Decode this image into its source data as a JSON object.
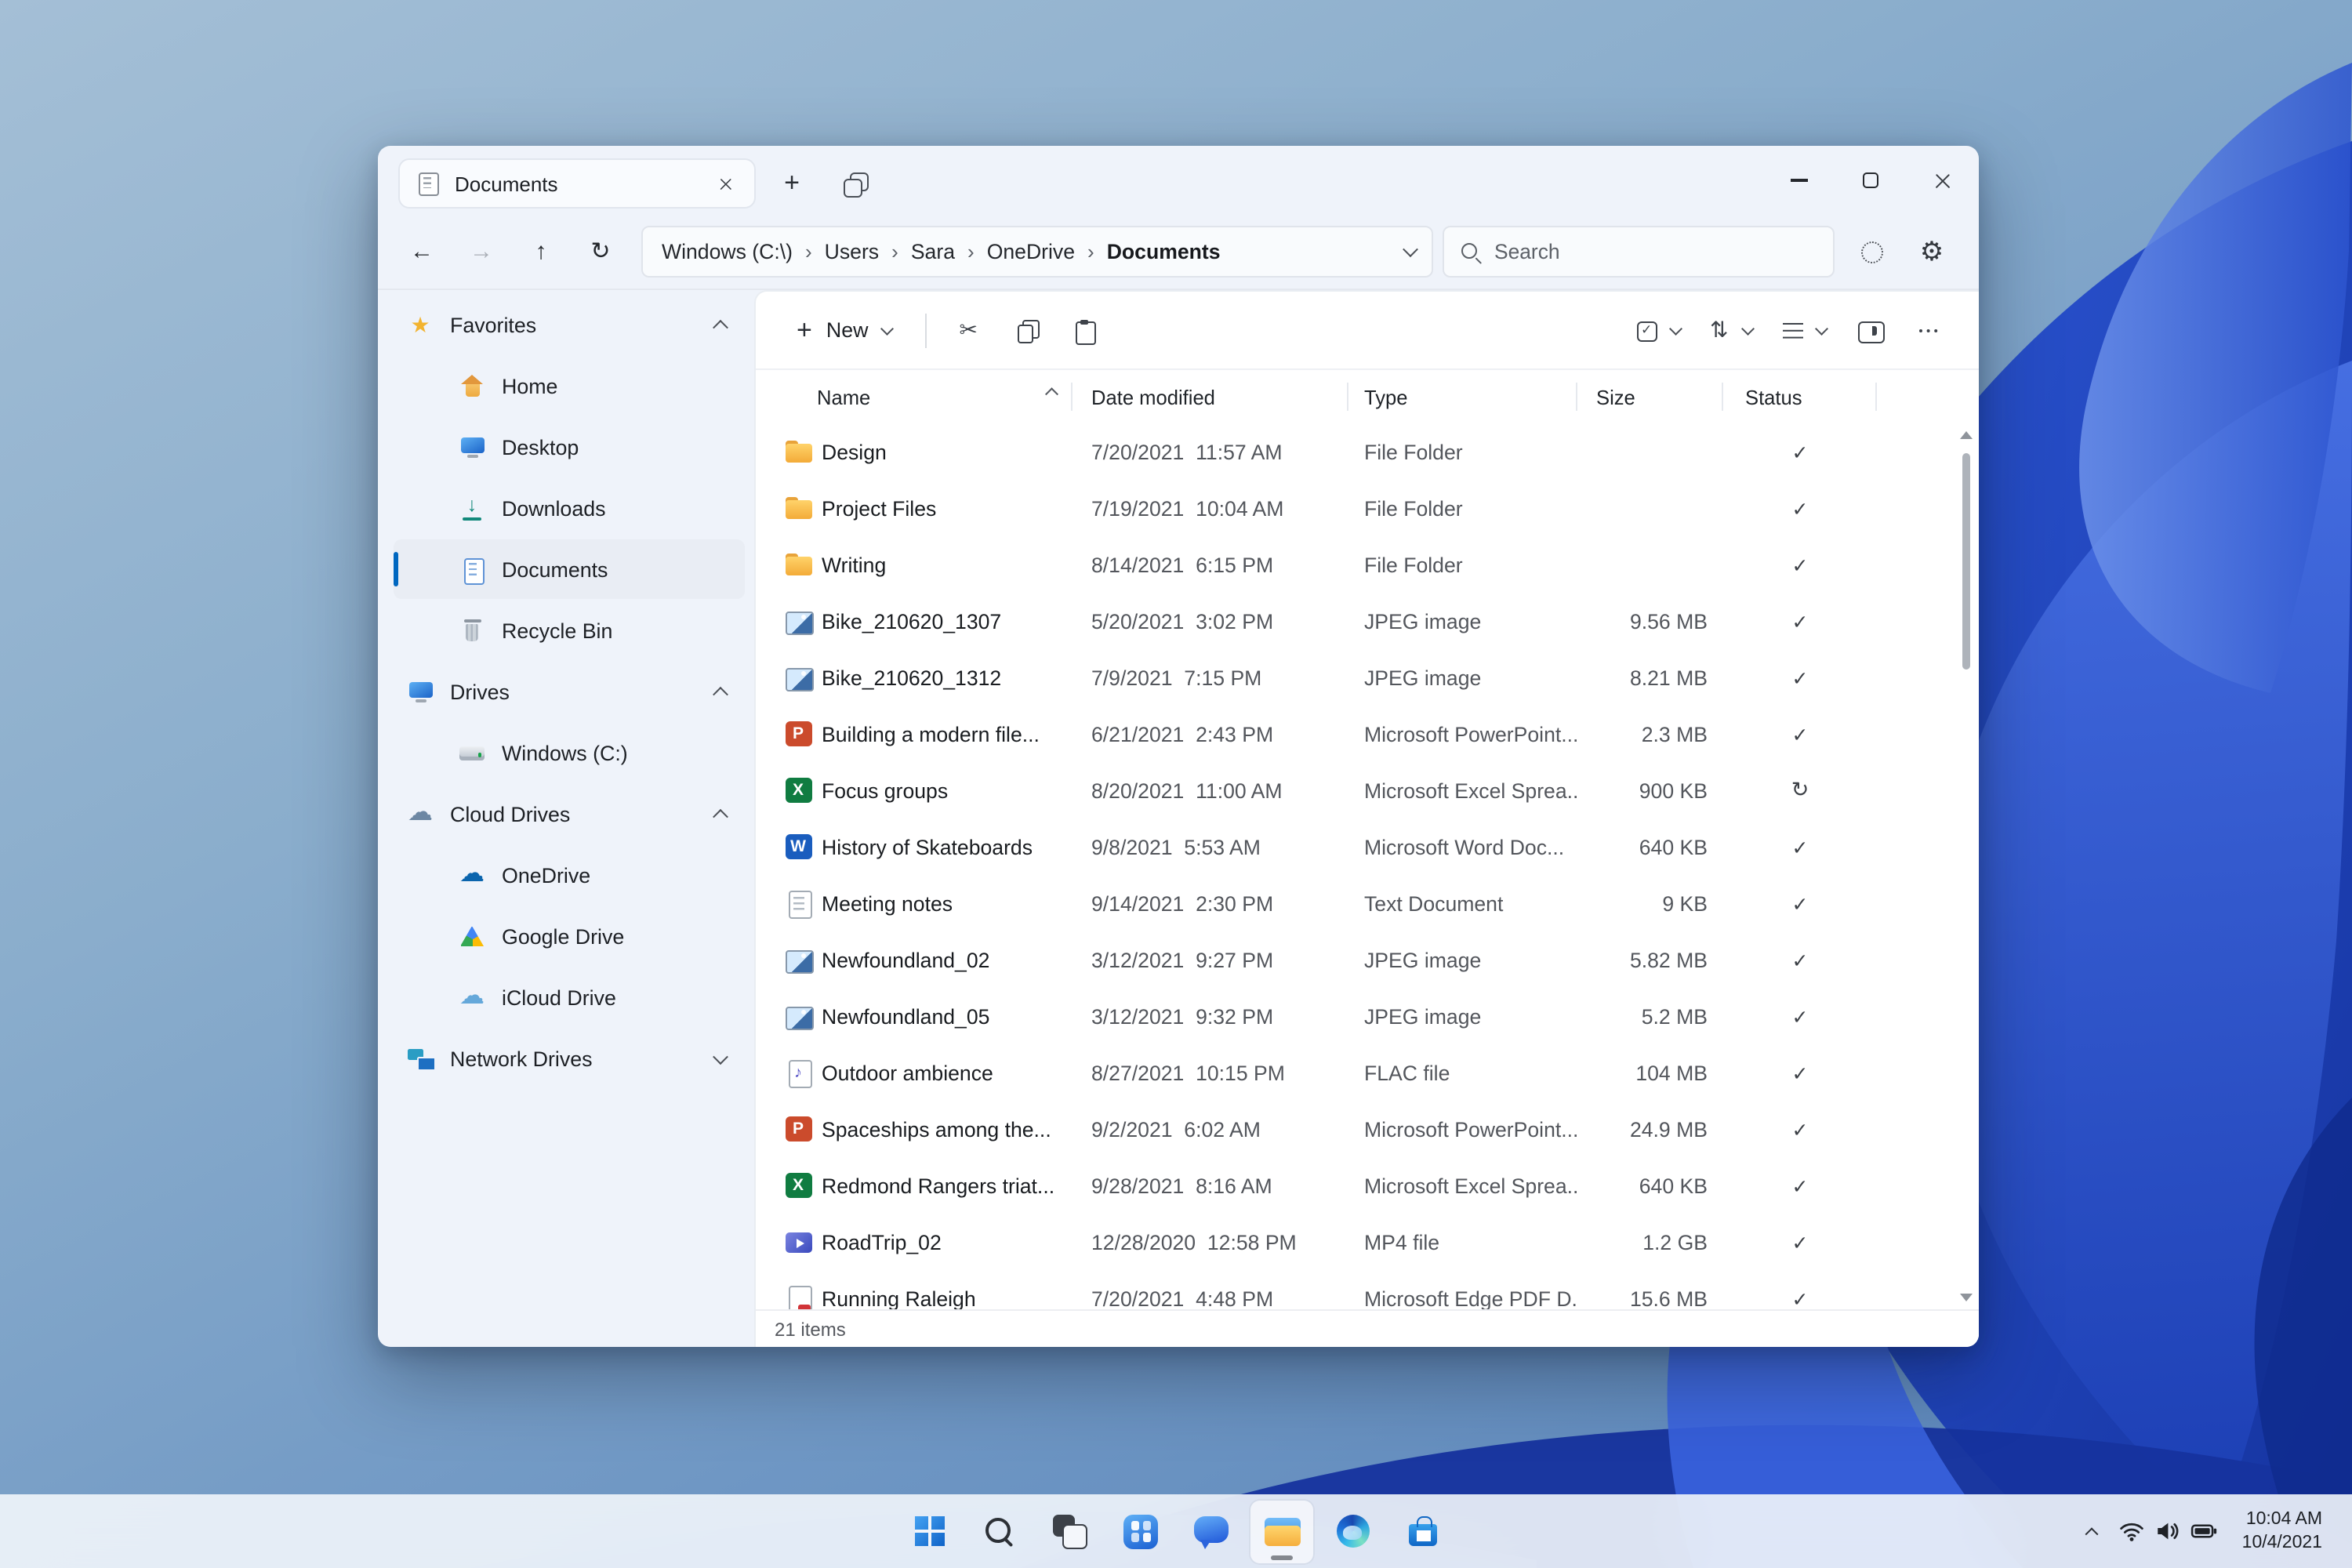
{
  "colors": {
    "accent": "#0067c0",
    "status_icon": "#3c4046",
    "wallpaper_deep_blue": "#1d44c2",
    "taskbar_bg": "#f2f6fb",
    "folder_yellow": "#f3ab38"
  },
  "explorer": {
    "tab_title": "Documents",
    "search_placeholder": "Search",
    "status_bar": "21 items",
    "toolbar": {
      "new_label": "New"
    },
    "breadcrumb": [
      {
        "label": "Windows (C:\\)",
        "sep": "›"
      },
      {
        "label": "Users",
        "sep": "›"
      },
      {
        "label": "Sara",
        "sep": "›"
      },
      {
        "label": "OneDrive",
        "sep": "›"
      },
      {
        "label": "Documents",
        "sep": "",
        "cls": "current"
      }
    ],
    "columns": [
      {
        "label": "Name",
        "cls": "h-name",
        "caret": "chev-up-sm"
      },
      {
        "label": "Date modified",
        "cls": "h-date",
        "caret": "chev-none"
      },
      {
        "label": "Type",
        "cls": "h-type",
        "caret": "chev-none"
      },
      {
        "label": "Size",
        "cls": "h-size",
        "caret": "chev-none"
      },
      {
        "label": "Status",
        "cls": "h-status",
        "caret": "chev-none"
      }
    ],
    "sidebar": [
      {
        "cls": "sec",
        "icon": "ic-star",
        "iconname": "star-icon",
        "label": "Favorites",
        "chev": "chev-up",
        "dname": "sidebar-section-favorites"
      },
      {
        "cls": "item",
        "icon": "ic-home",
        "iconname": "home-icon",
        "label": "Home",
        "chev": "chev-none",
        "dname": "sidebar-item-home"
      },
      {
        "cls": "item",
        "icon": "ic-desktop",
        "iconname": "desktop-icon",
        "label": "Desktop",
        "chev": "chev-none",
        "dname": "sidebar-item-desktop"
      },
      {
        "cls": "item",
        "icon": "ic-downloads",
        "iconname": "downloads-icon",
        "label": "Downloads",
        "chev": "chev-none",
        "dname": "sidebar-item-downloads"
      },
      {
        "cls": "item selected",
        "icon": "ic-documents",
        "iconname": "documents-icon",
        "label": "Documents",
        "chev": "chev-none",
        "dname": "sidebar-item-documents"
      },
      {
        "cls": "item",
        "icon": "ic-recycle",
        "iconname": "recycle-bin-icon",
        "label": "Recycle Bin",
        "chev": "chev-none",
        "dname": "sidebar-item-recycle-bin"
      },
      {
        "cls": "sec",
        "icon": "ic-monitor",
        "iconname": "monitor-icon",
        "label": "Drives",
        "chev": "chev-up",
        "dname": "sidebar-section-drives"
      },
      {
        "cls": "item",
        "icon": "ic-drive",
        "iconname": "hard-drive-icon",
        "label": "Windows (C:)",
        "chev": "chev-none",
        "dname": "sidebar-item-windows-c"
      },
      {
        "cls": "sec",
        "icon": "ic-cloud",
        "iconname": "cloud-icon",
        "label": "Cloud Drives",
        "chev": "chev-up",
        "dname": "sidebar-section-cloud-drives"
      },
      {
        "cls": "item",
        "icon": "ic-onedrive",
        "iconname": "onedrive-icon",
        "label": "OneDrive",
        "chev": "chev-none",
        "dname": "sidebar-item-onedrive"
      },
      {
        "cls": "item",
        "icon": "ic-gdrive",
        "iconname": "google-drive-icon",
        "label": "Google Drive",
        "chev": "chev-none",
        "dname": "sidebar-item-google-drive"
      },
      {
        "cls": "item",
        "icon": "ic-icloud",
        "iconname": "icloud-drive-icon",
        "label": "iCloud Drive",
        "chev": "chev-none",
        "dname": "sidebar-item-icloud-drive"
      },
      {
        "cls": "sec",
        "icon": "ic-network",
        "iconname": "network-icon",
        "label": "Network Drives",
        "chev": "chev-down",
        "dname": "sidebar-section-network-drives"
      }
    ],
    "files": [
      {
        "name": "Design",
        "date": "7/20/2021  11:57 AM",
        "type": "File Folder",
        "size": "",
        "icon": "icon-folder",
        "iconname": "folder-icon",
        "status": "st-check",
        "statusname": "check-icon"
      },
      {
        "name": "Project Files",
        "date": "7/19/2021  10:04 AM",
        "type": "File Folder",
        "size": "",
        "icon": "icon-folder",
        "iconname": "folder-icon",
        "status": "st-check",
        "statusname": "check-icon"
      },
      {
        "name": "Writing",
        "date": "8/14/2021  6:15 PM",
        "type": "File Folder",
        "size": "",
        "icon": "icon-folder",
        "iconname": "folder-icon",
        "status": "st-check",
        "statusname": "check-icon"
      },
      {
        "name": "Bike_210620_1307",
        "date": "5/20/2021  3:02 PM",
        "type": "JPEG image",
        "size": "9.56 MB",
        "icon": "icon-image",
        "iconname": "jpeg-image-icon",
        "status": "st-check",
        "statusname": "check-icon"
      },
      {
        "name": "Bike_210620_1312",
        "date": "7/9/2021  7:15 PM",
        "type": "JPEG image",
        "size": "8.21 MB",
        "icon": "icon-image",
        "iconname": "jpeg-image-icon",
        "status": "st-check",
        "statusname": "check-icon"
      },
      {
        "name": "Building a modern file...",
        "date": "6/21/2021  2:43 PM",
        "type": "Microsoft PowerPoint...",
        "size": "2.3 MB",
        "icon": "icon-ppt",
        "iconname": "powerpoint-icon",
        "status": "st-check",
        "statusname": "check-icon"
      },
      {
        "name": "Focus groups",
        "date": "8/20/2021  11:00 AM",
        "type": "Microsoft Excel Sprea...",
        "size": "900 KB",
        "icon": "icon-xls",
        "iconname": "excel-icon",
        "status": "st-sync",
        "statusname": "sync-icon"
      },
      {
        "name": "History of Skateboards",
        "date": "9/8/2021  5:53 AM",
        "type": "Microsoft Word Doc...",
        "size": "640 KB",
        "icon": "icon-doc",
        "iconname": "word-icon",
        "status": "st-check",
        "statusname": "check-icon"
      },
      {
        "name": "Meeting notes",
        "date": "9/14/2021  2:30 PM",
        "type": "Text Document",
        "size": "9 KB",
        "icon": "icon-txt",
        "iconname": "text-file-icon",
        "status": "st-check",
        "statusname": "check-icon"
      },
      {
        "name": "Newfoundland_02",
        "date": "3/12/2021  9:27 PM",
        "type": "JPEG image",
        "size": "5.82 MB",
        "icon": "icon-image",
        "iconname": "jpeg-image-icon",
        "status": "st-check",
        "statusname": "check-icon"
      },
      {
        "name": "Newfoundland_05",
        "date": "3/12/2021  9:32 PM",
        "type": "JPEG image",
        "size": "5.2 MB",
        "icon": "icon-image",
        "iconname": "jpeg-image-icon",
        "status": "st-check",
        "statusname": "check-icon"
      },
      {
        "name": "Outdoor ambience",
        "date": "8/27/2021  10:15 PM",
        "type": "FLAC file",
        "size": "104 MB",
        "icon": "icon-audio",
        "iconname": "audio-file-icon",
        "status": "st-check",
        "statusname": "check-icon"
      },
      {
        "name": "Spaceships among the...",
        "date": "9/2/2021  6:02 AM",
        "type": "Microsoft PowerPoint...",
        "size": "24.9 MB",
        "icon": "icon-ppt",
        "iconname": "powerpoint-icon",
        "status": "st-check",
        "statusname": "check-icon"
      },
      {
        "name": "Redmond Rangers triat...",
        "date": "9/28/2021  8:16 AM",
        "type": "Microsoft Excel Sprea...",
        "size": "640 KB",
        "icon": "icon-xls",
        "iconname": "excel-icon",
        "status": "st-check",
        "statusname": "check-icon"
      },
      {
        "name": "RoadTrip_02",
        "date": "12/28/2020  12:58 PM",
        "type": "MP4 file",
        "size": "1.2 GB",
        "icon": "icon-video",
        "iconname": "video-file-icon",
        "status": "st-check",
        "statusname": "check-icon"
      },
      {
        "name": "Running Raleigh",
        "date": "7/20/2021  4:48 PM",
        "type": "Microsoft Edge PDF D...",
        "size": "15.6 MB",
        "icon": "icon-pdf",
        "iconname": "pdf-file-icon",
        "status": "st-check",
        "statusname": "check-icon"
      }
    ]
  },
  "taskbar": {
    "buttons": [
      {
        "btn": "taskbar-start-button",
        "iconname": "start-icon",
        "icon": "tb-start"
      },
      {
        "btn": "taskbar-search-button",
        "iconname": "search-icon",
        "icon": "tb-search"
      },
      {
        "btn": "taskbar-task-view-button",
        "iconname": "task-view-icon",
        "icon": "tb-taskview"
      },
      {
        "btn": "taskbar-widgets-button",
        "iconname": "widgets-icon",
        "icon": "tb-widgets"
      },
      {
        "btn": "taskbar-chat-button",
        "iconname": "chat-icon",
        "icon": "tb-chat"
      },
      {
        "btn": "taskbar-explorer-button",
        "iconname": "file-explorer-icon",
        "icon": "tb-explorer",
        "cls": "active"
      },
      {
        "btn": "taskbar-edge-button",
        "iconname": "edge-icon",
        "icon": "tb-edge"
      },
      {
        "btn": "taskbar-store-button",
        "iconname": "store-icon",
        "icon": "tb-store"
      }
    ],
    "tray": {
      "time": "10:04 AM",
      "date": "10/4/2021"
    }
  }
}
